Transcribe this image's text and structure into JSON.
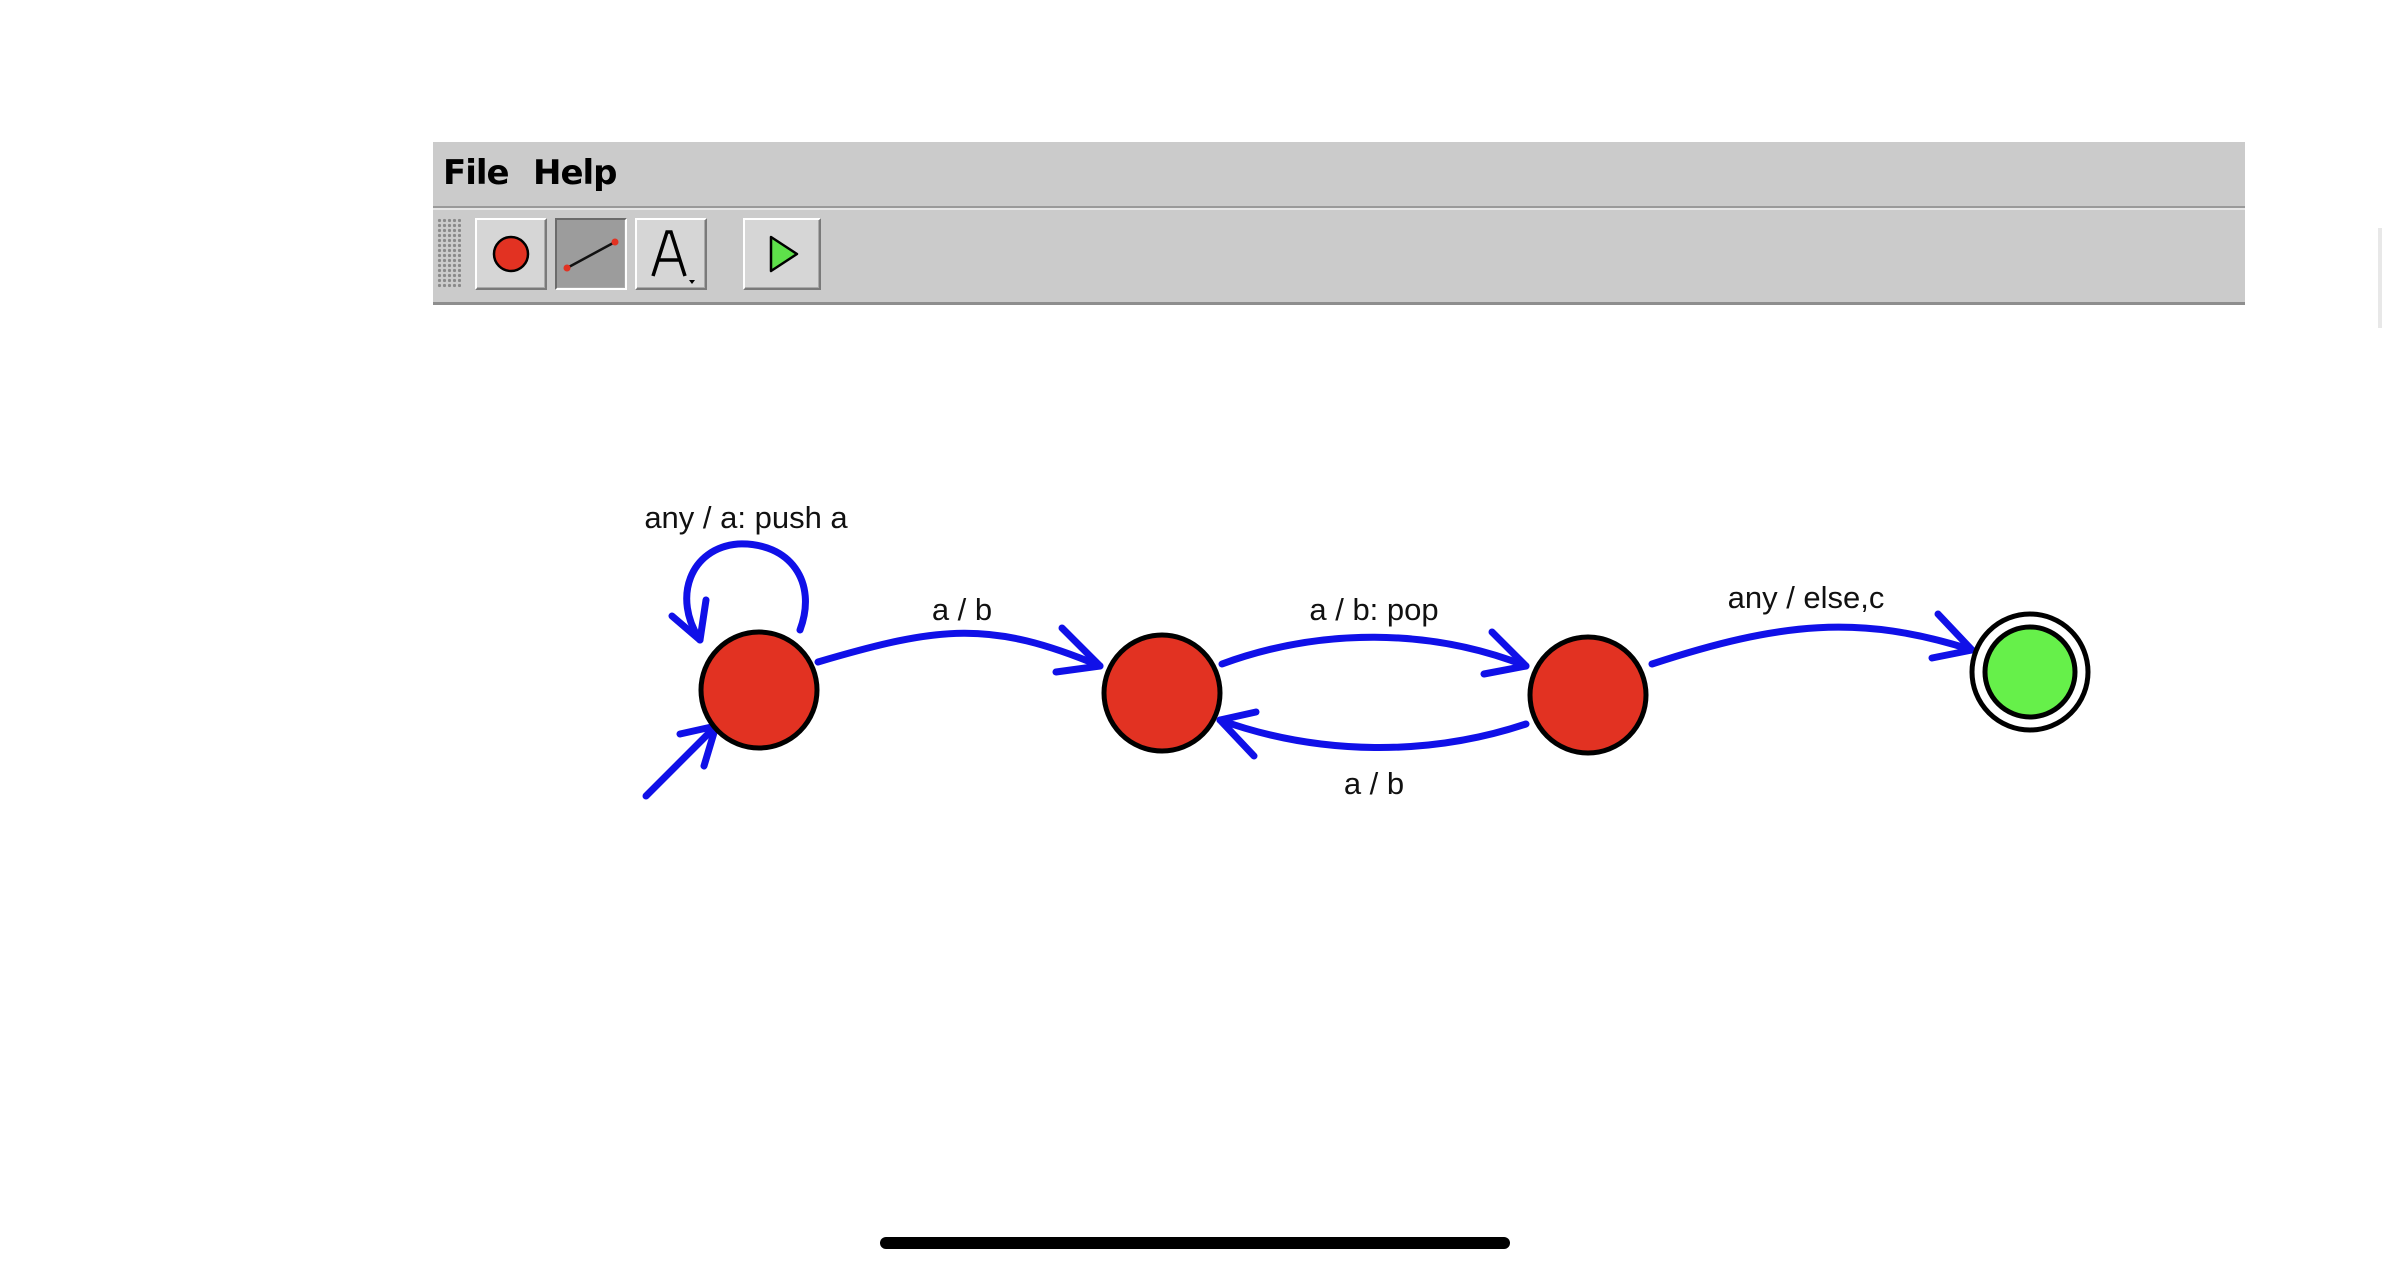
{
  "menu": {
    "file_label": "File",
    "help_label": "Help"
  },
  "toolbar": {
    "tools": [
      {
        "name": "state-tool",
        "icon": "red-circle-icon"
      },
      {
        "name": "transition-tool",
        "icon": "line-icon",
        "active": true
      },
      {
        "name": "label-tool",
        "icon": "text-A-icon"
      },
      {
        "name": "run-tool",
        "icon": "play-icon"
      }
    ]
  },
  "automaton": {
    "states": [
      {
        "id": "s0",
        "initial": true,
        "accepting": false,
        "color": "#e23222"
      },
      {
        "id": "s1",
        "initial": false,
        "accepting": false,
        "color": "#e23222"
      },
      {
        "id": "s2",
        "initial": false,
        "accepting": false,
        "color": "#e23222"
      },
      {
        "id": "s3",
        "initial": false,
        "accepting": true,
        "color": "#66f04a"
      }
    ],
    "transitions": [
      {
        "from": "s0",
        "to": "s0",
        "label": "any / a: push a"
      },
      {
        "from": "s0",
        "to": "s1",
        "label": "a / b"
      },
      {
        "from": "s1",
        "to": "s2",
        "label": "a / b: pop"
      },
      {
        "from": "s2",
        "to": "s1",
        "label": "a / b"
      },
      {
        "from": "s2",
        "to": "s3",
        "label": "any / else,c"
      }
    ],
    "edge_color": "#1010e8"
  }
}
